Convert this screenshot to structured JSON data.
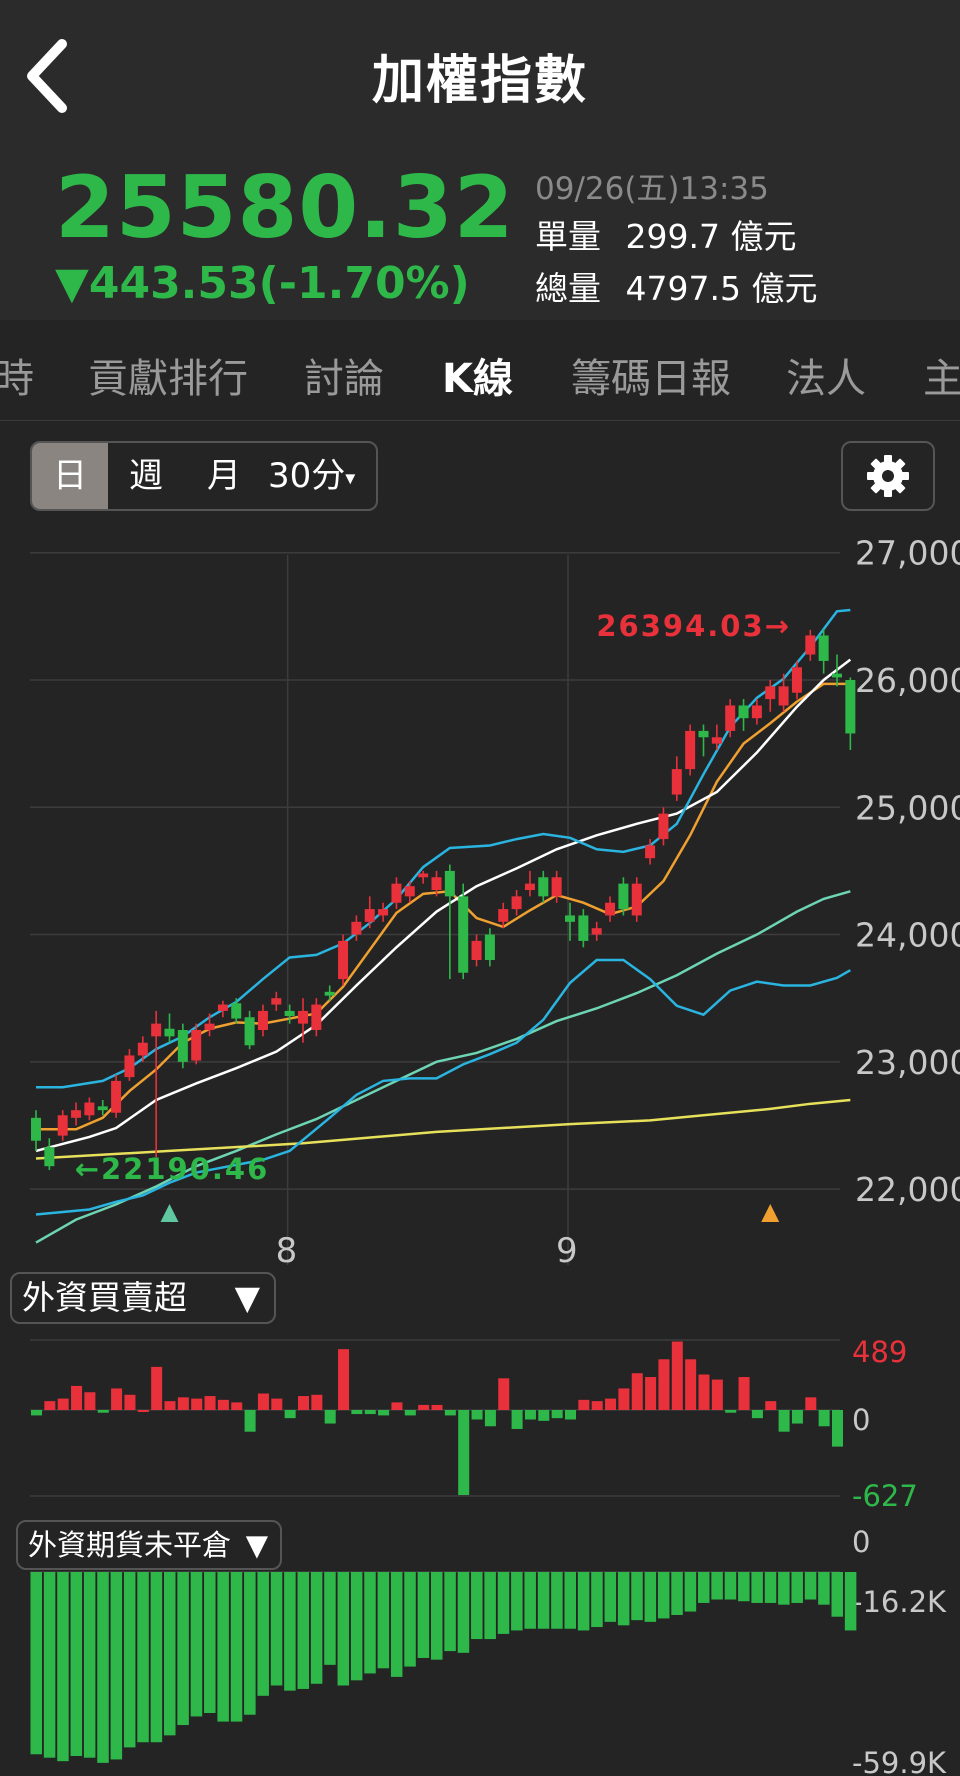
{
  "header": {
    "title": "加權指數",
    "back_icon": "chevron-left-icon"
  },
  "quote": {
    "price": "25580.32",
    "change": "▼443.53(-1.70%)",
    "timestamp": "09/26(五)13:35",
    "single_volume_label": "單量",
    "single_volume_value": "299.7 億元",
    "total_volume_label": "總量",
    "total_volume_value": "4797.5 億元",
    "down_color": "#2fb84a",
    "up_color": "#e8313a"
  },
  "tabs": [
    {
      "label": "時",
      "active": false
    },
    {
      "label": "貢獻排行",
      "active": false
    },
    {
      "label": "討論",
      "active": false
    },
    {
      "label": "K線",
      "active": true
    },
    {
      "label": "籌碼日報",
      "active": false
    },
    {
      "label": "法人",
      "active": false
    },
    {
      "label": "主",
      "active": false
    }
  ],
  "period": {
    "options": [
      "日",
      "週",
      "月",
      "30分"
    ],
    "selected": "日",
    "dropdown_marker": "▾"
  },
  "settings_icon": "gear-icon",
  "chart_data": [
    {
      "type": "candlestick",
      "title": "",
      "y_ticks": [
        "27,000",
        "26,000",
        "25,000",
        "24,000",
        "23,000",
        "22,000"
      ],
      "ylim": [
        21600,
        27100
      ],
      "x_ticks": [
        {
          "label": "8",
          "index": 19
        },
        {
          "label": "9",
          "index": 40
        }
      ],
      "high_marker": {
        "text": "26394.03→",
        "value": 26394.03,
        "index": 57,
        "color": "#e8313a"
      },
      "low_marker": {
        "text": "←22190.46",
        "value": 22190.46,
        "index": 2,
        "color": "#2fb84a"
      },
      "signals": [
        {
          "index": 10,
          "color": "#5fc8a0"
        },
        {
          "index": 55,
          "color": "#f0a030"
        }
      ],
      "candles": [
        [
          22560,
          22380,
          22620,
          22300
        ],
        [
          22330,
          22180,
          22400,
          22150
        ],
        [
          22420,
          22580,
          22620,
          22380
        ],
        [
          22560,
          22620,
          22680,
          22500
        ],
        [
          22580,
          22680,
          22720,
          22540
        ],
        [
          22650,
          22620,
          22700,
          22580
        ],
        [
          22600,
          22850,
          22900,
          22560
        ],
        [
          22880,
          23050,
          23100,
          22850
        ],
        [
          23050,
          23150,
          23200,
          23000
        ],
        [
          23200,
          23300,
          23400,
          22250
        ],
        [
          23260,
          23200,
          23380,
          23150
        ],
        [
          23250,
          23000,
          23300,
          22950
        ],
        [
          23010,
          23250,
          23300,
          22980
        ],
        [
          23250,
          23300,
          23380,
          23200
        ],
        [
          23400,
          23450,
          23480,
          23350
        ],
        [
          23460,
          23340,
          23500,
          23300
        ],
        [
          23350,
          23130,
          23400,
          23100
        ],
        [
          23250,
          23400,
          23450,
          23200
        ],
        [
          23450,
          23500,
          23550,
          23400
        ],
        [
          23400,
          23360,
          23450,
          23300
        ],
        [
          23300,
          23400,
          23500,
          23150
        ],
        [
          23250,
          23450,
          23500,
          23200
        ],
        [
          23550,
          23520,
          23600,
          23480
        ],
        [
          23650,
          23950,
          24000,
          23600
        ],
        [
          24000,
          24100,
          24150,
          23950
        ],
        [
          24100,
          24200,
          24300,
          24050
        ],
        [
          24150,
          24200,
          24250,
          24100
        ],
        [
          24250,
          24400,
          24450,
          24200
        ],
        [
          24300,
          24380,
          24420,
          24250
        ],
        [
          24450,
          24480,
          24500,
          24400
        ],
        [
          24350,
          24450,
          24500,
          24300
        ],
        [
          24500,
          24300,
          24550,
          23650
        ],
        [
          24300,
          23700,
          24400,
          23650
        ],
        [
          23800,
          23950,
          24000,
          23750
        ],
        [
          24000,
          23800,
          24050,
          23750
        ],
        [
          24100,
          24200,
          24250,
          24050
        ],
        [
          24200,
          24300,
          24350,
          24150
        ],
        [
          24350,
          24400,
          24500,
          24300
        ],
        [
          24450,
          24300,
          24500,
          24250
        ],
        [
          24300,
          24450,
          24500,
          24250
        ],
        [
          24150,
          24100,
          24250,
          23950
        ],
        [
          24150,
          23950,
          24200,
          23900
        ],
        [
          24000,
          24050,
          24100,
          23950
        ],
        [
          24150,
          24250,
          24300,
          24100
        ],
        [
          24400,
          24200,
          24450,
          24150
        ],
        [
          24150,
          24400,
          24450,
          24100
        ],
        [
          24600,
          24700,
          24750,
          24550
        ],
        [
          24750,
          24950,
          25000,
          24700
        ],
        [
          25100,
          25300,
          25400,
          25050
        ],
        [
          25300,
          25600,
          25650,
          25250
        ],
        [
          25600,
          25550,
          25650,
          25400
        ],
        [
          25500,
          25550,
          25650,
          25450
        ],
        [
          25600,
          25800,
          25850,
          25550
        ],
        [
          25800,
          25700,
          25850,
          25600
        ],
        [
          25700,
          25800,
          25850,
          25650
        ],
        [
          25850,
          25950,
          26000,
          25750
        ],
        [
          25800,
          25950,
          26050,
          25750
        ],
        [
          25900,
          26100,
          26150,
          25850
        ],
        [
          26200,
          26350,
          26394.03,
          26150
        ],
        [
          26350,
          26150,
          26400,
          26050
        ],
        [
          26050,
          26020,
          26200,
          25950
        ],
        [
          26000,
          25580,
          26020,
          25450
        ]
      ],
      "ma_lines": [
        {
          "color": "#f0a030",
          "points": [
            [
              0,
              22470
            ],
            [
              3,
              22470
            ],
            [
              5,
              22560
            ],
            [
              7,
              22770
            ],
            [
              9,
              22940
            ],
            [
              11,
              23150
            ],
            [
              13,
              23260
            ],
            [
              15,
              23310
            ],
            [
              17,
              23300
            ],
            [
              19,
              23340
            ],
            [
              21,
              23380
            ],
            [
              23,
              23590
            ],
            [
              25,
              23880
            ],
            [
              27,
              24170
            ],
            [
              29,
              24320
            ],
            [
              31,
              24340
            ],
            [
              33,
              24130
            ],
            [
              35,
              24060
            ],
            [
              37,
              24190
            ],
            [
              39,
              24310
            ],
            [
              41,
              24250
            ],
            [
              43,
              24160
            ],
            [
              45,
              24220
            ],
            [
              47,
              24420
            ],
            [
              49,
              24780
            ],
            [
              51,
              25200
            ],
            [
              53,
              25500
            ],
            [
              55,
              25660
            ],
            [
              57,
              25830
            ],
            [
              59,
              25970
            ],
            [
              61,
              25970
            ]
          ]
        },
        {
          "color": "#ffffff",
          "points": [
            [
              0,
              22300
            ],
            [
              4,
              22410
            ],
            [
              6,
              22480
            ],
            [
              9,
              22700
            ],
            [
              12,
              22830
            ],
            [
              15,
              22950
            ],
            [
              18,
              23080
            ],
            [
              21,
              23290
            ],
            [
              24,
              23600
            ],
            [
              27,
              23900
            ],
            [
              30,
              24180
            ],
            [
              33,
              24380
            ],
            [
              36,
              24520
            ],
            [
              39,
              24670
            ],
            [
              42,
              24780
            ],
            [
              45,
              24870
            ],
            [
              48,
              24950
            ],
            [
              51,
              25120
            ],
            [
              54,
              25430
            ],
            [
              57,
              25790
            ],
            [
              59,
              26000
            ],
            [
              61,
              26160
            ]
          ]
        },
        {
          "color": "#6dd4b4",
          "points": [
            [
              0,
              21580
            ],
            [
              3,
              21760
            ],
            [
              6,
              21880
            ],
            [
              9,
              22020
            ],
            [
              12,
              22180
            ],
            [
              15,
              22300
            ],
            [
              18,
              22430
            ],
            [
              21,
              22550
            ],
            [
              24,
              22700
            ],
            [
              27,
              22850
            ],
            [
              30,
              23000
            ],
            [
              33,
              23070
            ],
            [
              36,
              23180
            ],
            [
              39,
              23320
            ],
            [
              42,
              23420
            ],
            [
              45,
              23540
            ],
            [
              48,
              23680
            ],
            [
              51,
              23850
            ],
            [
              54,
              24000
            ],
            [
              57,
              24180
            ],
            [
              59,
              24280
            ],
            [
              61,
              24340
            ]
          ]
        },
        {
          "color": "#e6e05a",
          "points": [
            [
              0,
              22240
            ],
            [
              10,
              22300
            ],
            [
              20,
              22360
            ],
            [
              30,
              22450
            ],
            [
              40,
              22510
            ],
            [
              46,
              22540
            ],
            [
              50,
              22580
            ],
            [
              55,
              22630
            ],
            [
              58,
              22670
            ],
            [
              61,
              22700
            ]
          ]
        },
        {
          "color": "#2ab4e0",
          "points": [
            [
              0,
              22800
            ],
            [
              2,
              22800
            ],
            [
              5,
              22850
            ],
            [
              7,
              22950
            ],
            [
              9,
              23100
            ],
            [
              11,
              23200
            ],
            [
              13,
              23350
            ],
            [
              15,
              23470
            ],
            [
              17,
              23650
            ],
            [
              19,
              23820
            ],
            [
              21,
              23840
            ],
            [
              23,
              23930
            ],
            [
              25,
              24090
            ],
            [
              27,
              24280
            ],
            [
              29,
              24530
            ],
            [
              31,
              24680
            ],
            [
              34,
              24700
            ],
            [
              36,
              24750
            ],
            [
              38,
              24790
            ],
            [
              40,
              24760
            ],
            [
              42,
              24670
            ],
            [
              44,
              24650
            ],
            [
              46,
              24700
            ],
            [
              48,
              24870
            ],
            [
              50,
              25260
            ],
            [
              52,
              25630
            ],
            [
              54,
              25860
            ],
            [
              56,
              26010
            ],
            [
              58,
              26260
            ],
            [
              60,
              26540
            ],
            [
              61,
              26550
            ]
          ]
        },
        {
          "color": "#2ab4e0",
          "points": [
            [
              0,
              21800
            ],
            [
              2,
              21820
            ],
            [
              4,
              21840
            ],
            [
              6,
              21900
            ],
            [
              8,
              21950
            ],
            [
              10,
              22050
            ],
            [
              12,
              22130
            ],
            [
              14,
              22170
            ],
            [
              17,
              22230
            ],
            [
              19,
              22300
            ],
            [
              22,
              22560
            ],
            [
              24,
              22740
            ],
            [
              26,
              22850
            ],
            [
              28,
              22870
            ],
            [
              30,
              22870
            ],
            [
              32,
              22980
            ],
            [
              34,
              23060
            ],
            [
              36,
              23150
            ],
            [
              38,
              23330
            ],
            [
              40,
              23620
            ],
            [
              42,
              23800
            ],
            [
              44,
              23800
            ],
            [
              46,
              23650
            ],
            [
              48,
              23440
            ],
            [
              50,
              23370
            ],
            [
              52,
              23560
            ],
            [
              54,
              23630
            ],
            [
              56,
              23600
            ],
            [
              58,
              23600
            ],
            [
              60,
              23660
            ],
            [
              61,
              23720
            ]
          ]
        }
      ]
    },
    {
      "type": "bar",
      "title": "外資買賣超",
      "y_ticks": [
        "489",
        "0",
        "-627"
      ],
      "ylim": [
        -627,
        489
      ],
      "values": [
        -40,
        70,
        90,
        190,
        140,
        -20,
        170,
        120,
        0,
        340,
        70,
        100,
        90,
        110,
        80,
        60,
        -160,
        130,
        90,
        -60,
        110,
        120,
        -100,
        480,
        -30,
        -30,
        -40,
        60,
        -40,
        40,
        40,
        -40,
        -627,
        -70,
        -120,
        250,
        -140,
        -70,
        -80,
        -60,
        -70,
        80,
        70,
        90,
        170,
        290,
        260,
        400,
        540,
        400,
        280,
        240,
        -20,
        260,
        -60,
        70,
        -160,
        -100,
        100,
        -120,
        -270
      ]
    },
    {
      "type": "bar",
      "title": "外資期貨未平倉",
      "y_ticks": [
        "0",
        "-16.2K",
        "-59.9K"
      ],
      "ylim": [
        -61000,
        0
      ],
      "values": [
        -53000,
        -54000,
        -55000,
        -53500,
        -54000,
        -55500,
        -54500,
        -51000,
        -49500,
        -49500,
        -47500,
        -44500,
        -42000,
        -41000,
        -43500,
        -43500,
        -41500,
        -36000,
        -33000,
        -34500,
        -34000,
        -32500,
        -27000,
        -33000,
        -31500,
        -29500,
        -28000,
        -30500,
        -27500,
        -25000,
        -25500,
        -23000,
        -23500,
        -19500,
        -19500,
        -18000,
        -17000,
        -16500,
        -16500,
        -16500,
        -16500,
        -17000,
        -16000,
        -14500,
        -15500,
        -14000,
        -14500,
        -13500,
        -12500,
        -11500,
        -9000,
        -8000,
        -8000,
        -8500,
        -9000,
        -9000,
        -9500,
        -9000,
        -8000,
        -9500,
        -13000,
        -17000
      ]
    }
  ]
}
